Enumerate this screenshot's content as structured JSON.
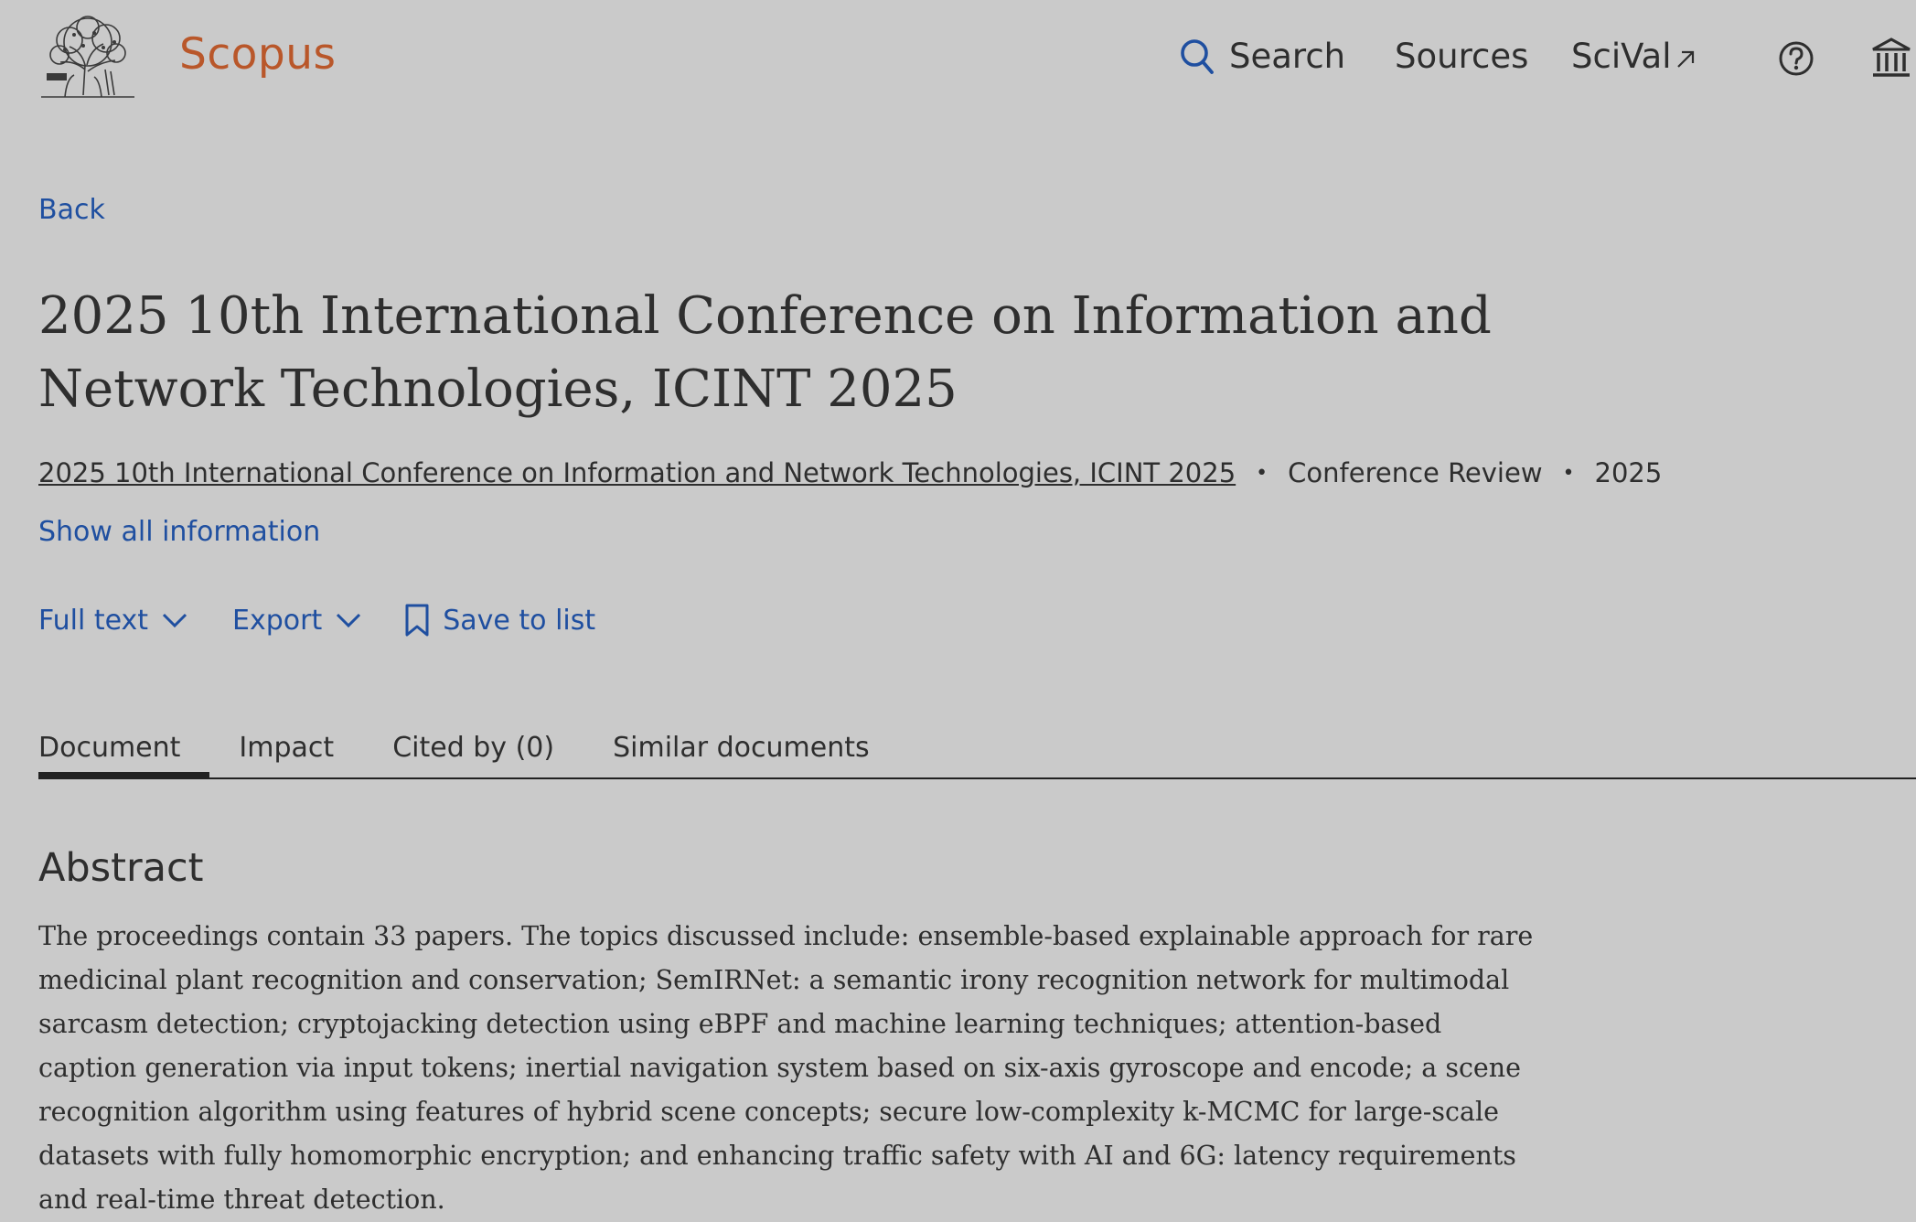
{
  "header": {
    "brand": "Scopus",
    "nav": {
      "search": "Search",
      "sources": "Sources",
      "scival": "SciVal"
    }
  },
  "back_label": "Back",
  "document": {
    "title": "2025 10th International Conference on Information and Network Technologies, ICINT 2025",
    "source_title": "2025 10th International Conference on Information and Network Technologies, ICINT 2025",
    "doc_type": "Conference Review",
    "year": "2025"
  },
  "show_all_label": "Show all information",
  "actions": {
    "full_text": "Full text",
    "export": "Export",
    "save_to_list": "Save to list"
  },
  "tabs": [
    {
      "label": "Document",
      "active": true
    },
    {
      "label": "Impact",
      "active": false
    },
    {
      "label": "Cited by (0)",
      "active": false
    },
    {
      "label": "Similar documents",
      "active": false
    }
  ],
  "abstract": {
    "heading": "Abstract",
    "text": "The proceedings contain 33 papers. The topics discussed include: ensemble-based explainable approach for rare medicinal plant recognition and conservation; SemIRNet: a semantic irony recognition network for multimodal sarcasm detection; cryptojacking detection using eBPF and machine learning techniques; attention-based caption generation via input tokens; inertial navigation system based on six-axis gyroscope and encode; a scene recognition algorithm using features of hybrid scene concepts; secure low-complexity k-MCMC for large-scale datasets with fully homomorphic encryption; and enhancing traffic safety with AI and 6G: latency requirements and real-time threat detection."
  },
  "colors": {
    "background": "#cacaca",
    "brand": "#b9572a",
    "link": "#1f4fa0",
    "text": "#2e2e2e"
  },
  "icons": [
    "elsevier-tree-logo",
    "search-icon",
    "external-link-icon",
    "help-icon",
    "institution-icon",
    "chevron-down-icon",
    "bookmark-icon"
  ]
}
